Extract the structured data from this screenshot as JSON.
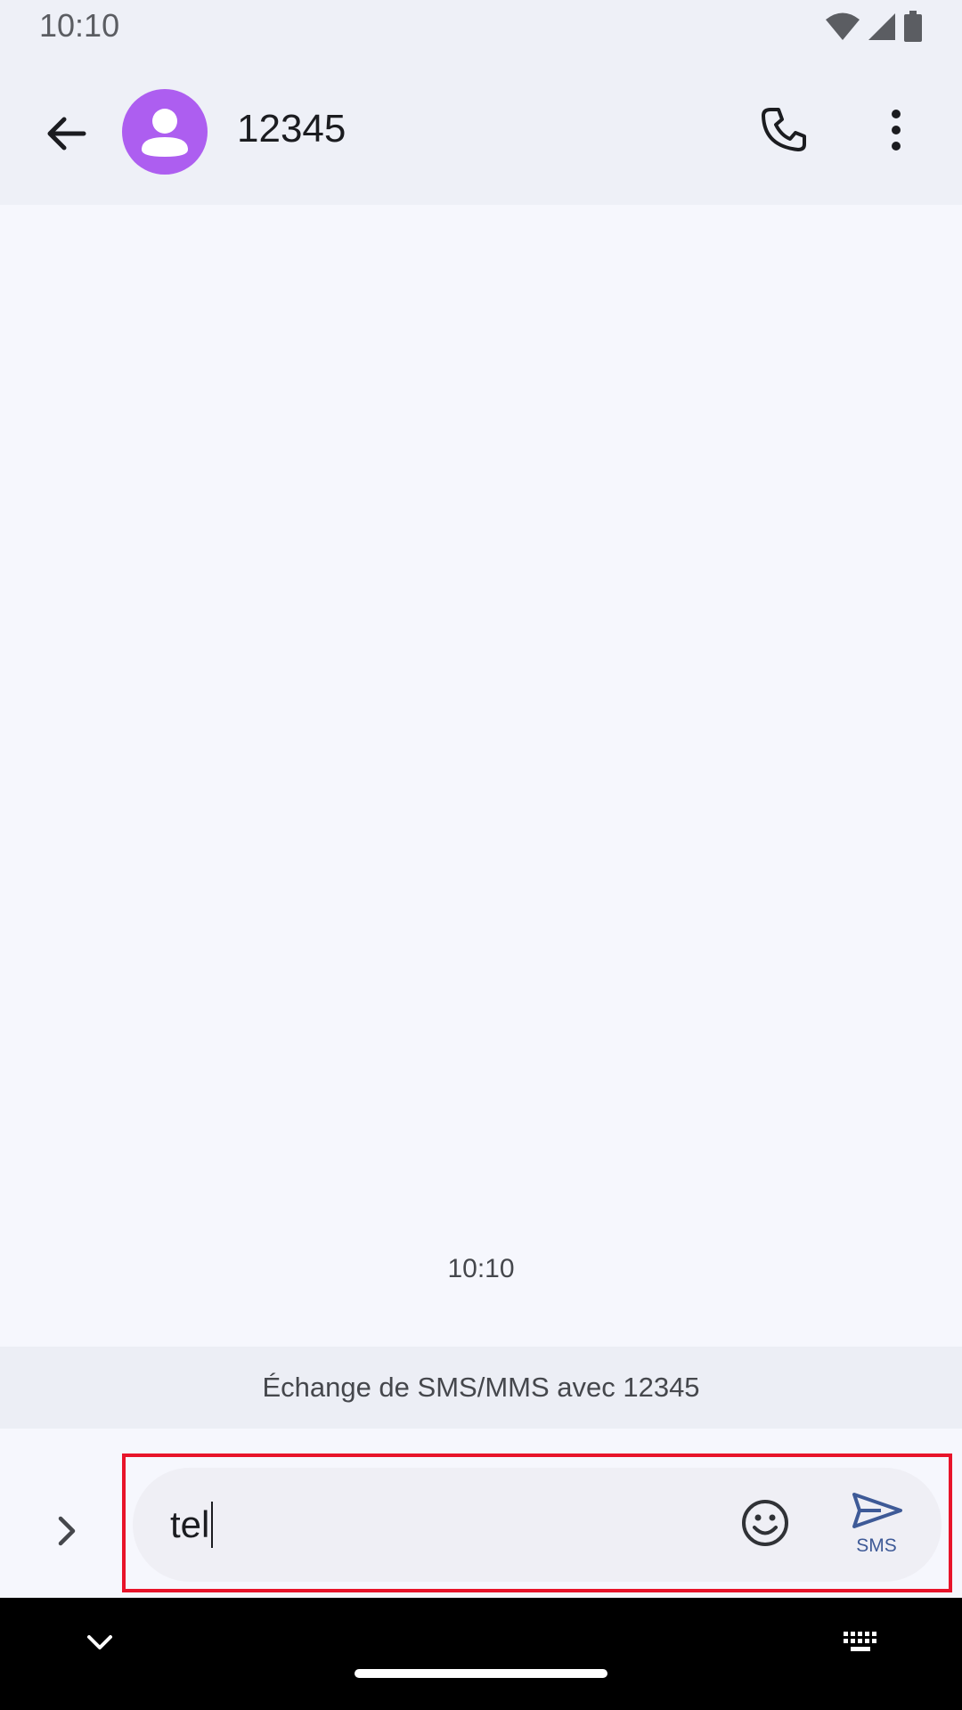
{
  "status_bar": {
    "time": "10:10",
    "icons": [
      "wifi-icon",
      "cellular-signal-icon",
      "battery-icon"
    ]
  },
  "app_bar": {
    "back_icon": "arrow-back-icon",
    "avatar_icon": "person-icon",
    "avatar_color": "#ad5ef0",
    "contact_name": "12345",
    "call_icon": "phone-icon",
    "more_icon": "more-vert-icon"
  },
  "conversation": {
    "timestamp": "10:10"
  },
  "banner": {
    "text": "Échange de SMS/MMS avec 12345"
  },
  "compose": {
    "expand_icon": "chevron-right-icon",
    "value": "tel",
    "emoji_icon": "emoji-icon",
    "send_icon": "send-icon",
    "send_label": "SMS",
    "send_color": "#3e5a97"
  },
  "nav_bar": {
    "collapse_icon": "chevron-down-icon",
    "keyboard_icon": "keyboard-icon"
  },
  "highlight_color": "#e8142a"
}
